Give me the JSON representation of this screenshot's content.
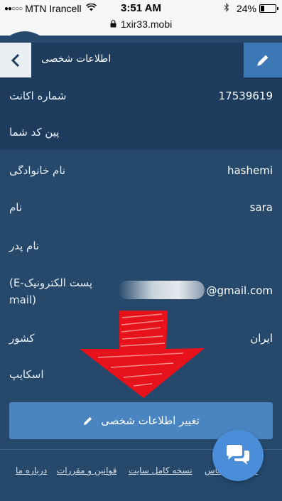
{
  "status_bar": {
    "signal": "●●○○○",
    "carrier": "MTN Irancell",
    "time": "3:51 AM",
    "battery": "24%",
    "battery_level": 0.24,
    "url": "1xir33.mobi"
  },
  "header": {
    "title": "اطلاعات شخصی"
  },
  "fields": {
    "account_number": {
      "label": "شماره اکانت",
      "value": "17539619"
    },
    "pin": {
      "label": "پین کد شما",
      "value": ""
    },
    "last_name": {
      "label": "نام خانوادگی",
      "value": "hashemi"
    },
    "first_name": {
      "label": "نام",
      "value": "sara"
    },
    "father_name": {
      "label": "نام پدر",
      "value": ""
    },
    "email": {
      "label_line1": "(E-پست الکترونیک",
      "label_line2": "mail)",
      "value_visible": "@gmail.com"
    },
    "country": {
      "label": "کشور",
      "value": "ایران"
    },
    "skype": {
      "label": "اسکایپ",
      "value": ""
    }
  },
  "buttons": {
    "change_info": "تغییر اطلاعات شخصی"
  },
  "footer": {
    "links": [
      "درباره ما",
      "قوانین و مقررات",
      "نسخه کامل سایت",
      "اطلاعات تماس"
    ]
  },
  "colors": {
    "page_bg": "#25486b",
    "header_bg": "#1d3c5e",
    "button_bg": "#4a84c1",
    "edit_bg": "#3b78b5",
    "arrow_red": "#e8121c",
    "chat_bg": "#4a8ed9"
  },
  "icons": {
    "back": "chevron-left-icon",
    "edit": "pencil-icon",
    "chat": "chat-bubbles-icon"
  }
}
